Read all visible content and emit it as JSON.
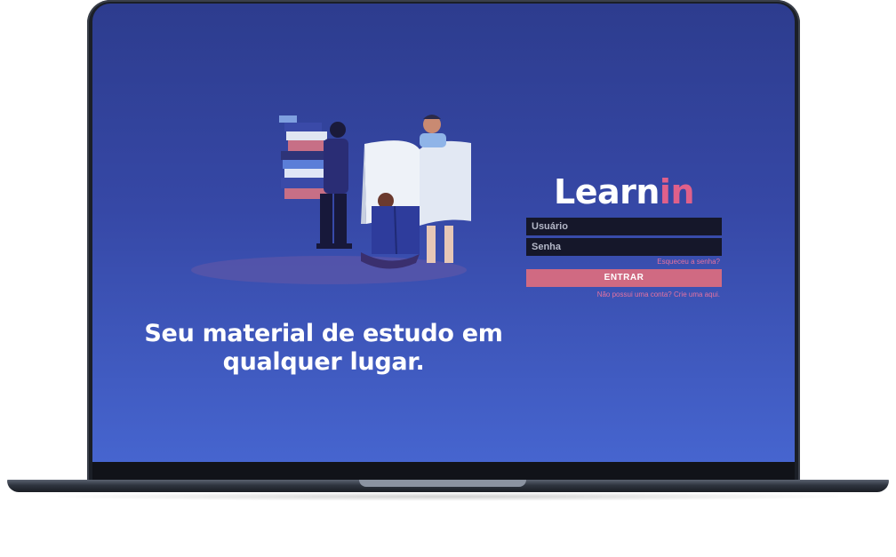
{
  "hero": {
    "headline_line1": "Seu material de estudo em",
    "headline_line2": "qualquer lugar."
  },
  "brand": {
    "part1": "Learn",
    "part2": "in"
  },
  "login": {
    "username_placeholder": "Usuário",
    "password_placeholder": "Senha",
    "forgot_link": "Esqueceu a senha?",
    "submit_label": "ENTRAR",
    "signup_link": "Não possui uma conta? Crie uma aqui."
  },
  "colors": {
    "background_top": "#2d3c8e",
    "background_bottom": "#4665cf",
    "accent": "#e0608a",
    "button": "#d06a82",
    "input_bg": "#15172a"
  },
  "icons": {
    "illustration": "people-reading-books-illustration"
  }
}
